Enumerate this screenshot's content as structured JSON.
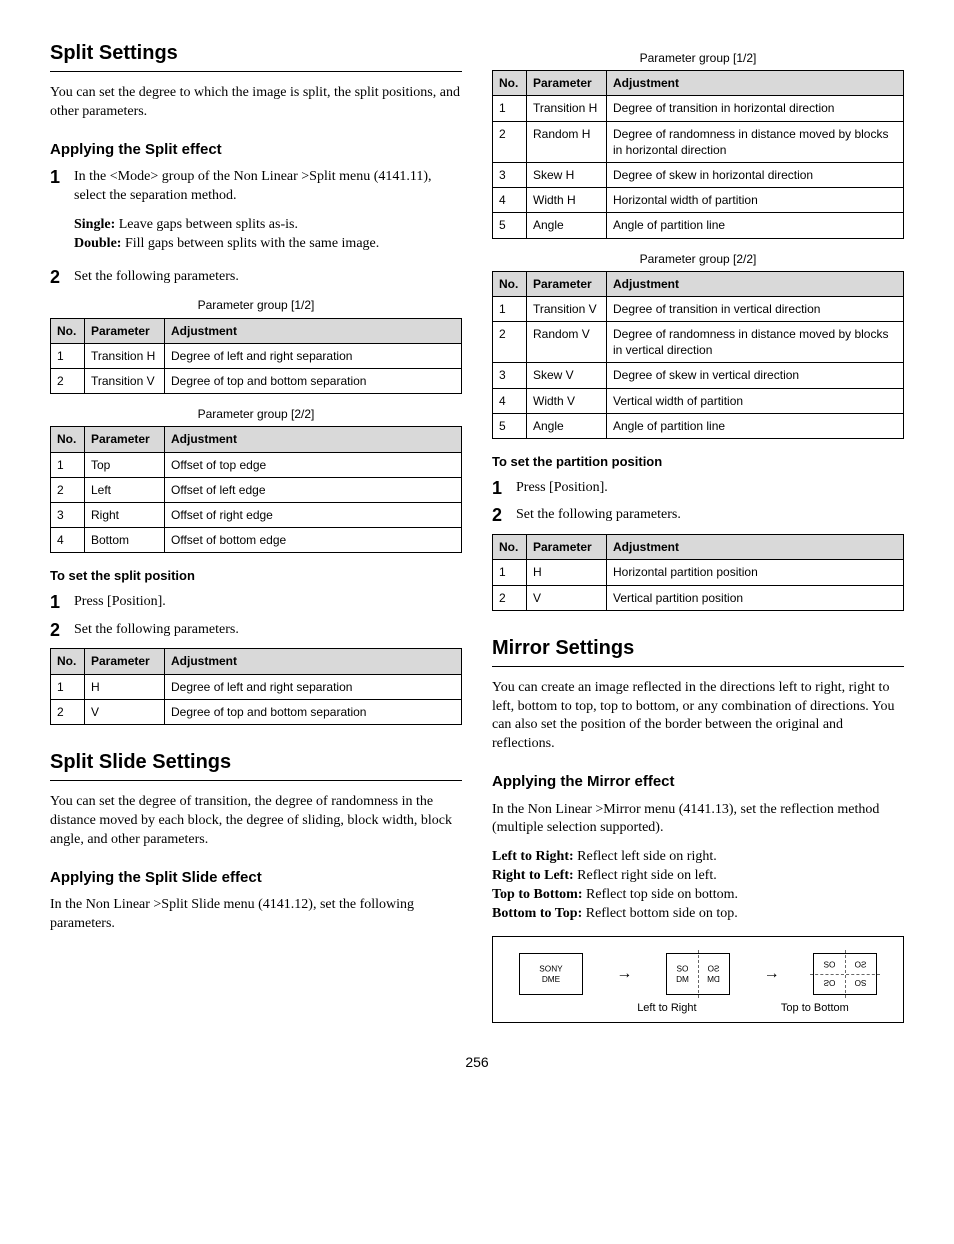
{
  "page_number": "256",
  "left": {
    "split_settings": {
      "heading": "Split Settings",
      "intro": "You can set the degree to which the image is split, the split positions, and other parameters.",
      "apply_heading": "Applying the Split effect",
      "step1": "In the <Mode> group of the Non Linear >Split menu (4141.11), select the separation method.",
      "single_label": "Single:",
      "single_text": " Leave gaps between splits as-is.",
      "double_label": "Double:",
      "double_text": " Fill gaps between splits with the same image.",
      "step2": "Set the following parameters.",
      "group1_caption": "Parameter group [1/2]",
      "group1_headers": {
        "no": "No.",
        "param": "Parameter",
        "adj": "Adjustment"
      },
      "group1_rows": [
        {
          "no": "1",
          "param": "Transition H",
          "adj": "Degree of left and right separation"
        },
        {
          "no": "2",
          "param": "Transition V",
          "adj": "Degree of top and bottom separation"
        }
      ],
      "group2_caption": "Parameter group [2/2]",
      "group2_rows": [
        {
          "no": "1",
          "param": "Top",
          "adj": "Offset of top edge"
        },
        {
          "no": "2",
          "param": "Left",
          "adj": "Offset of left edge"
        },
        {
          "no": "3",
          "param": "Right",
          "adj": "Offset of right edge"
        },
        {
          "no": "4",
          "param": "Bottom",
          "adj": "Offset of bottom edge"
        }
      ],
      "pos_heading": "To set the split position",
      "pos_step1": "Press [Position].",
      "pos_step2": "Set the following parameters.",
      "pos_rows": [
        {
          "no": "1",
          "param": "H",
          "adj": "Degree of left and right separation"
        },
        {
          "no": "2",
          "param": "V",
          "adj": "Degree of top and bottom separation"
        }
      ]
    },
    "split_slide": {
      "heading": "Split Slide Settings",
      "intro": "You can set the degree of transition, the degree of randomness in the distance moved by each block, the degree of sliding, block width, block angle, and other parameters.",
      "apply_heading": "Applying the Split Slide effect",
      "apply_text": "In the Non Linear >Split Slide menu (4141.12), set the following parameters."
    }
  },
  "right": {
    "slide": {
      "group1_caption": "Parameter group [1/2]",
      "headers": {
        "no": "No.",
        "param": "Parameter",
        "adj": "Adjustment"
      },
      "group1_rows": [
        {
          "no": "1",
          "param": "Transition H",
          "adj": "Degree of transition in horizontal direction"
        },
        {
          "no": "2",
          "param": "Random H",
          "adj": "Degree of randomness in distance moved by blocks in horizontal direction"
        },
        {
          "no": "3",
          "param": "Skew H",
          "adj": "Degree of skew in horizontal direction"
        },
        {
          "no": "4",
          "param": "Width H",
          "adj": "Horizontal width of partition"
        },
        {
          "no": "5",
          "param": "Angle",
          "adj": "Angle of partition line"
        }
      ],
      "group2_caption": "Parameter group [2/2]",
      "group2_rows": [
        {
          "no": "1",
          "param": "Transition V",
          "adj": "Degree of transition in vertical direction"
        },
        {
          "no": "2",
          "param": "Random V",
          "adj": "Degree of randomness in distance moved by blocks in vertical direction"
        },
        {
          "no": "3",
          "param": "Skew V",
          "adj": "Degree of skew in vertical direction"
        },
        {
          "no": "4",
          "param": "Width V",
          "adj": "Vertical width of partition"
        },
        {
          "no": "5",
          "param": "Angle",
          "adj": "Angle of partition line"
        }
      ],
      "pos_heading": "To set the partition position",
      "pos_step1": "Press [Position].",
      "pos_step2": "Set the following parameters.",
      "pos_rows": [
        {
          "no": "1",
          "param": "H",
          "adj": "Horizontal partition position"
        },
        {
          "no": "2",
          "param": "V",
          "adj": "Vertical partition position"
        }
      ]
    },
    "mirror": {
      "heading": "Mirror Settings",
      "intro": "You can create an image reflected in the directions left to right, right to left, bottom to top, top to bottom, or any combination of directions. You can also set the position of the border between the original and reflections.",
      "apply_heading": "Applying the Mirror effect",
      "apply_text": "In the Non Linear >Mirror menu (4141.13), set the reflection method (multiple selection supported).",
      "lr_label": "Left to Right:",
      "lr_text": " Reflect left side on right.",
      "rl_label": "Right to Left:",
      "rl_text": " Reflect right side on left.",
      "tb_label": "Top to Bottom:",
      "tb_text": " Reflect top side on bottom.",
      "bt_label": "Bottom to Top:",
      "bt_text": " Reflect bottom side on top.",
      "diag_label_lr": "Left to Right",
      "diag_label_tb": "Top to Bottom",
      "box_text": "SONY\nDME"
    }
  }
}
